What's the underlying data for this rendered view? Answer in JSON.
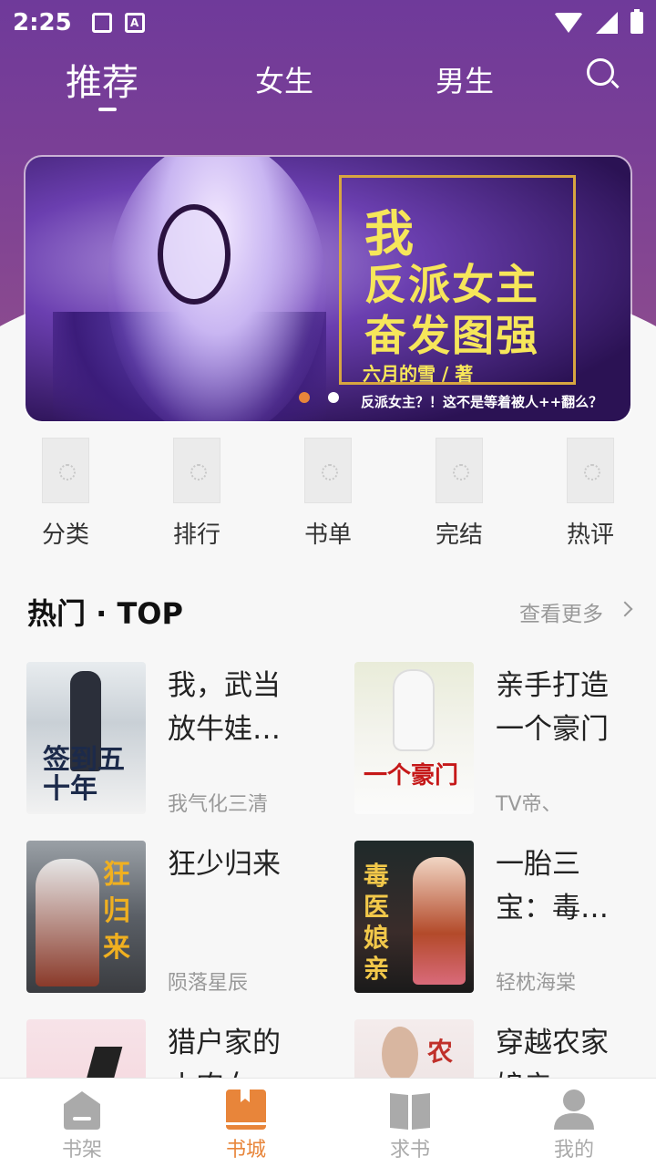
{
  "status_bar": {
    "time": "2:25",
    "icons": [
      "image-icon",
      "font-icon",
      "wifi-icon",
      "signal-icon",
      "battery-icon"
    ],
    "font_icon_glyph": "A"
  },
  "header": {
    "tabs": [
      {
        "label": "推荐",
        "active": true
      },
      {
        "label": "女生",
        "active": false
      },
      {
        "label": "男生",
        "active": false
      }
    ],
    "search_icon": "search-icon"
  },
  "banner": {
    "title_line_1": "我",
    "title_line_2": "反派女主",
    "title_line_3": "奋发图强",
    "author": "六月的雪 / 著",
    "tagline": "反派女主？！这不是等着被人++翻么？",
    "page_count": 2,
    "active_index": 0
  },
  "categories": [
    {
      "label": "分类"
    },
    {
      "label": "排行"
    },
    {
      "label": "书单"
    },
    {
      "label": "完结"
    },
    {
      "label": "热评"
    }
  ],
  "hot_section": {
    "title": "热门 · TOP",
    "see_more": "查看更多"
  },
  "books": [
    {
      "title": "我，武当放牛娃…",
      "author": "我气化三清",
      "cover_text": "签到五十年"
    },
    {
      "title": "亲手打造一个豪门",
      "author": "TV帝、",
      "cover_text": "一个豪门"
    },
    {
      "title": "狂少归来",
      "author": "陨落星辰",
      "cover_text": "狂归来"
    },
    {
      "title": "一胎三宝：毒…",
      "author": "轻枕海棠",
      "cover_text": "毒医娘亲"
    },
    {
      "title": "猎户家的小农女",
      "author": "",
      "cover_text": ""
    },
    {
      "title": "穿越农家娘亲…",
      "author": "",
      "cover_text": "农"
    }
  ],
  "bottom_nav": [
    {
      "label": "书架",
      "icon": "bookshelf-icon",
      "active": false
    },
    {
      "label": "书城",
      "icon": "bookstore-icon",
      "active": true
    },
    {
      "label": "求书",
      "icon": "open-book-icon",
      "active": false
    },
    {
      "label": "我的",
      "icon": "profile-icon",
      "active": false
    }
  ],
  "colors": {
    "header_purple": "#6f3a9a",
    "accent_orange": "#e8853a",
    "banner_title_yellow": "#f6e65a"
  }
}
